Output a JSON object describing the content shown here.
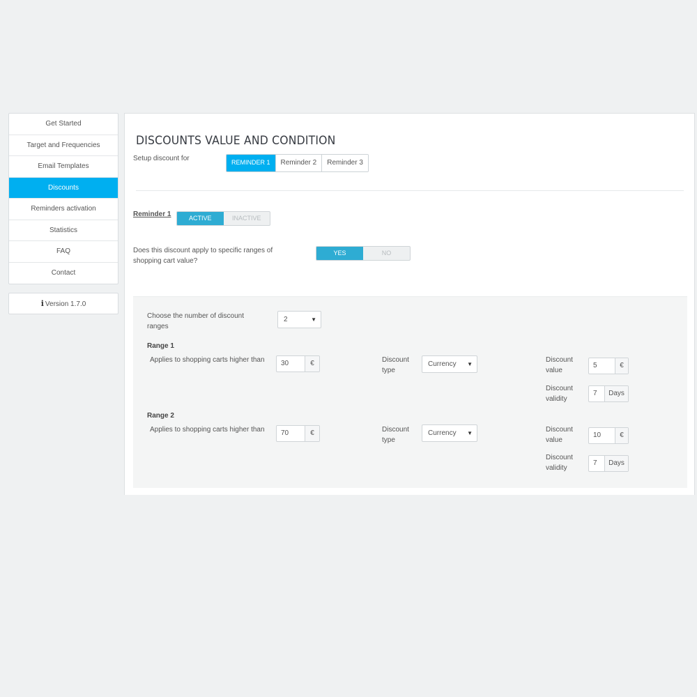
{
  "sidebar": {
    "items": [
      {
        "label": "Get Started"
      },
      {
        "label": "Target and Frequencies"
      },
      {
        "label": "Email Templates"
      },
      {
        "label": "Discounts"
      },
      {
        "label": "Reminders activation"
      },
      {
        "label": "Statistics"
      },
      {
        "label": "FAQ"
      },
      {
        "label": "Contact"
      }
    ],
    "active_index": 3,
    "version": "Version 1.7.0"
  },
  "main": {
    "title": "DISCOUNTS VALUE AND CONDITION",
    "setup_label": "Setup discount for",
    "reminder_tabs": [
      "REMINDER 1",
      "Reminder 2",
      "Reminder 3"
    ],
    "selected_tab": 0,
    "reminder_label": "Reminder 1",
    "active_switch": {
      "on": "ACTIVE",
      "off": "INACTIVE",
      "value": "ACTIVE"
    },
    "question": "Does this discount apply to specific ranges of shopping cart value?",
    "yesno_switch": {
      "on": "YES",
      "off": "NO",
      "value": "YES"
    },
    "ranges_box": {
      "count_label": "Choose the number of discount ranges",
      "count_value": "2",
      "ranges": [
        {
          "title": "Range 1",
          "applies_label": "Applies to shopping carts higher than",
          "threshold": "30",
          "threshold_unit": "€",
          "type_label": "Discount type",
          "type_value": "Currency",
          "value_label": "Discount value",
          "value": "5",
          "value_unit": "€",
          "validity_label": "Discount validity",
          "validity": "7",
          "validity_unit": "Days"
        },
        {
          "title": "Range 2",
          "applies_label": "Applies to shopping carts higher than",
          "threshold": "70",
          "threshold_unit": "€",
          "type_label": "Discount type",
          "type_value": "Currency",
          "value_label": "Discount value",
          "value": "10",
          "value_unit": "€",
          "validity_label": "Discount validity",
          "validity": "7",
          "validity_unit": "Days"
        }
      ]
    }
  },
  "colors": {
    "accent": "#00aff0",
    "switch_on": "#2eacd3",
    "background": "#eff1f2"
  },
  "icons": {
    "version": "info-icon",
    "dropdown": "caret-down-icon"
  }
}
